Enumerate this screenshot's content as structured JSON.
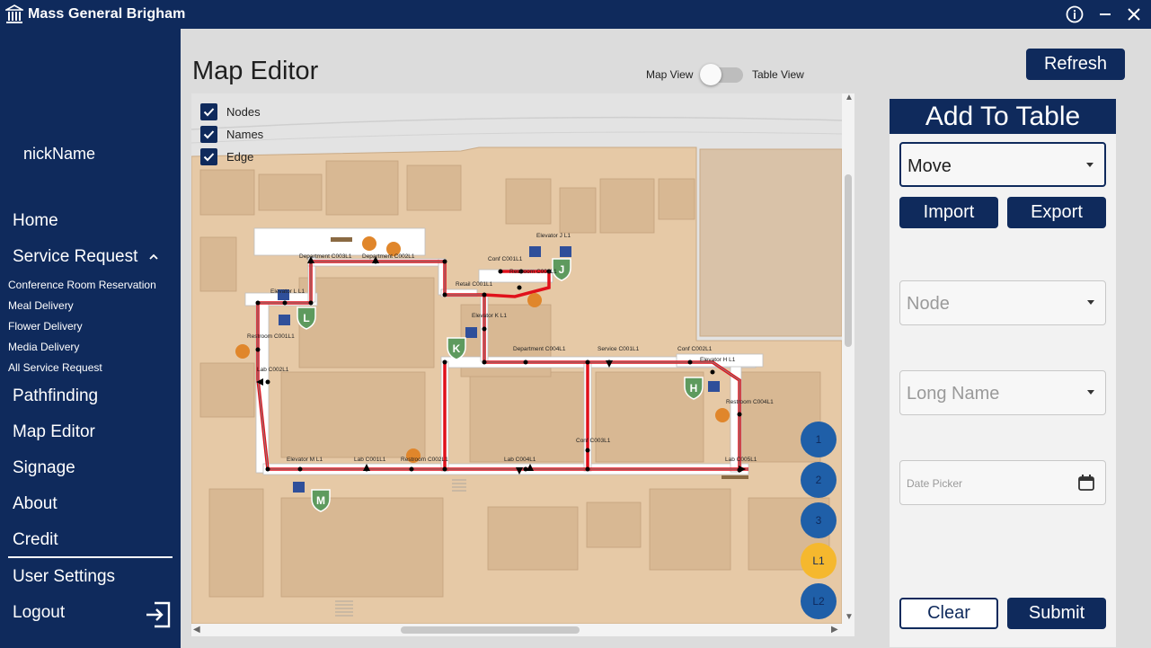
{
  "titlebar": {
    "brand": "Mass General Brigham",
    "icons": [
      "hospital-logo-icon",
      "info-icon",
      "minimize-icon",
      "close-icon"
    ]
  },
  "sidebar": {
    "nickname": "nickName",
    "nav": {
      "home": "Home",
      "service_request": "Service Request",
      "pathfinding": "Pathfinding",
      "map_editor": "Map Editor",
      "signage": "Signage",
      "about": "About",
      "credit": "Credit",
      "user_settings": "User Settings",
      "logout": "Logout"
    },
    "service_items": {
      "conference": "Conference Room Reservation",
      "meal": "Meal Delivery",
      "flower": "Flower Delivery",
      "media": "Media Delivery",
      "all": "All Service Request"
    }
  },
  "main": {
    "title": "Map Editor",
    "view_toggle": {
      "left_label": "Map View",
      "right_label": "Table View",
      "table_view_on": false
    },
    "refresh_label": "Refresh"
  },
  "map": {
    "checks": {
      "nodes": "Nodes",
      "names": "Names",
      "edge": "Edge"
    },
    "floors": [
      "1",
      "2",
      "3",
      "L1",
      "L2"
    ],
    "active_floor": "L1",
    "node_labels": {
      "elevator_ll1": "Elevator L L1",
      "elevator_kl1": "Elevator K L1",
      "elevator_jl1": "Elevator J L1",
      "elevator_hl1": "Elevator H L1",
      "elevator_ml1": "Elevator M L1",
      "dept_c003": "Department C003L1",
      "dept_c002": "Department C002L1",
      "dept_c004": "Department C004L1",
      "retail_c001": "Retail C001L1",
      "restroom_c001": "Restroom C001L1",
      "restroom_c003": "Restroom C003L1",
      "restroom_c004": "Restroom C004L1",
      "restroom_c002": "Restroom C002L1",
      "lab_c002": "Lab C002L1",
      "lab_c001": "Lab C001L1",
      "lab_c004": "Lab C004L1",
      "lab_c005": "Lab C005L1",
      "conf_c001": "Conf C001L1",
      "conf_c002": "Conf C002L1",
      "conf_c003": "Conf C003L1",
      "service_c001": "Service C001L1"
    },
    "zone_letters": {
      "l": "L",
      "k": "K",
      "j": "J",
      "h": "H",
      "m": "M"
    },
    "colors": {
      "building": "#e6c9a6",
      "building_dark": "#d8b893",
      "corridor": "#ffffff",
      "path": "#e0111b",
      "zone": "#5e9a5e",
      "elevator": "#2f4f9a",
      "restroom": "#e0862b"
    }
  },
  "panel": {
    "header": "Add To Table",
    "type_value": "Move",
    "import_label": "Import",
    "export_label": "Export",
    "node_placeholder": "Node",
    "longname_placeholder": "Long Name",
    "date_placeholder": "Date Picker",
    "clear_label": "Clear",
    "submit_label": "Submit"
  },
  "theme": {
    "navy": "#0f2a5c",
    "floor_blue": "#1f5fa8",
    "floor_active": "#f5b82e"
  }
}
